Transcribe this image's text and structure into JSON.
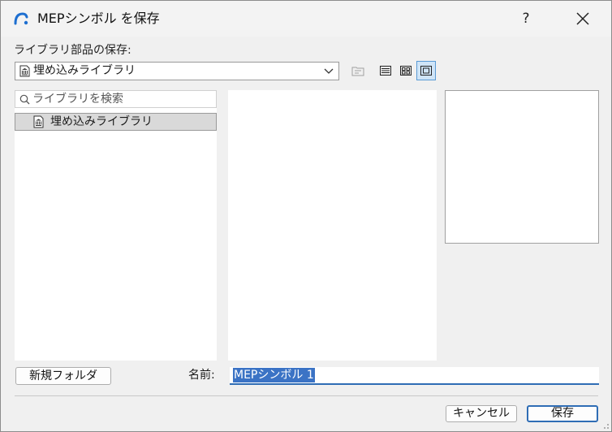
{
  "window": {
    "title": "MEPシンボル を保存",
    "help_label": "?",
    "accent_color": "#2f6db5"
  },
  "icons": {
    "app": "archicad-logo-icon",
    "help": "help-icon",
    "close": "close-icon",
    "library": "library-icon",
    "dropdown": "chevron-down-icon",
    "new_folder": "new-folder-icon",
    "list_view": "list-view-icon",
    "grid_view": "grid-view-icon",
    "preview_view": "preview-view-icon",
    "search": "search-icon"
  },
  "library": {
    "section_label": "ライブラリ部品の保存:",
    "selected_library": "埋め込みライブラリ",
    "view_mode_selected": "preview"
  },
  "search": {
    "placeholder": "ライブラリを検索",
    "value": ""
  },
  "tree": {
    "items": [
      {
        "label": "埋め込みライブラリ",
        "selected": true
      }
    ]
  },
  "footer": {
    "new_folder_label": "新規フォルダ",
    "name_label": "名前:",
    "name_value": "MEPシンボル 1",
    "cancel_label": "キャンセル",
    "save_label": "保存"
  }
}
